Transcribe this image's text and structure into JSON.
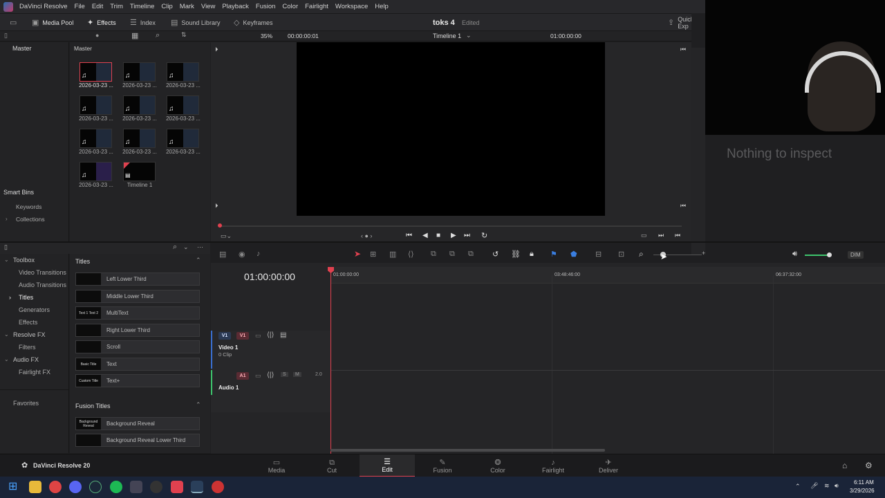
{
  "menubar": {
    "app_name": "DaVinci Resolve",
    "items": [
      "File",
      "Edit",
      "Trim",
      "Timeline",
      "Clip",
      "Mark",
      "View",
      "Playback",
      "Fusion",
      "Color",
      "Fairlight",
      "Workspace",
      "Help"
    ]
  },
  "toolbar": {
    "media_pool": "Media Pool",
    "effects": "Effects",
    "index": "Index",
    "sound_library": "Sound Library",
    "keyframes": "Keyframes",
    "project_name": "toks 4",
    "project_status": "Edited",
    "quick_export": "Quick Exp"
  },
  "subbar": {
    "zoom": "35%",
    "source_timecode": "00:00:00:01",
    "timeline_name": "Timeline 1",
    "timeline_timecode": "01:00:00:00"
  },
  "left": {
    "master": "Master",
    "smart_bins": "Smart Bins",
    "keywords": "Keywords",
    "collections": "Collections"
  },
  "pool": {
    "header": "Master",
    "clips": [
      "2026-03-23 ...",
      "2026-03-23 ...",
      "2026-03-23 ...",
      "2026-03-23 ...",
      "2026-03-23 ...",
      "2026-03-23 ...",
      "2026-03-23 ...",
      "2026-03-23 ...",
      "2026-03-23 ...",
      "2026-03-23 ..."
    ],
    "timeline_label": "Timeline 1"
  },
  "inspector": {
    "empty": "Nothing to inspect"
  },
  "fxtree": {
    "toolbox": "Toolbox",
    "video_transitions": "Video Transitions",
    "audio_transitions": "Audio Transitions",
    "titles": "Titles",
    "generators": "Generators",
    "effects": "Effects",
    "resolve_fx": "Resolve FX",
    "filters": "Filters",
    "audio_fx": "Audio FX",
    "fairlight_fx": "Fairlight FX",
    "favorites": "Favorites"
  },
  "fxlist": {
    "titles_header": "Titles",
    "titles": [
      {
        "thumb": "",
        "name": "Left Lower Third"
      },
      {
        "thumb": "",
        "name": "Middle Lower Third"
      },
      {
        "thumb": "Text 1 Text 2",
        "name": "MultiText"
      },
      {
        "thumb": "",
        "name": "Right Lower Third"
      },
      {
        "thumb": "",
        "name": "Scroll"
      },
      {
        "thumb": "Basic Title",
        "name": "Text"
      },
      {
        "thumb": "Custom Title",
        "name": "Text+"
      }
    ],
    "fusion_header": "Fusion Titles",
    "fusion_titles": [
      {
        "thumb": "Background Reveal",
        "name": "Background Reveal"
      },
      {
        "thumb": "",
        "name": "Background Reveal Lower Third"
      }
    ]
  },
  "timeline": {
    "timecode": "01:00:00:00",
    "ruler": [
      "01:00:00:00",
      "03:48:46:00",
      "06:37:32:00"
    ],
    "dim": "DIM",
    "v1": "V1",
    "video_track": "Video 1",
    "video_clips": "0 Clip",
    "a1": "A1",
    "audio_track": "Audio 1",
    "audio_channels": "2.0",
    "solo": "S",
    "mute": "M"
  },
  "bottom": {
    "version": "DaVinci Resolve 20",
    "pages": [
      "Media",
      "Cut",
      "Edit",
      "Fusion",
      "Color",
      "Fairlight",
      "Deliver"
    ],
    "active_page": "Edit"
  },
  "taskbar": {
    "time": "6:11 AM",
    "date": "3/29/2026"
  },
  "colors": {
    "accent_red": "#e0414f",
    "active_page": "#e0414f",
    "v1_badge": "#e86a6a",
    "audio_green": "#3ec46d"
  }
}
